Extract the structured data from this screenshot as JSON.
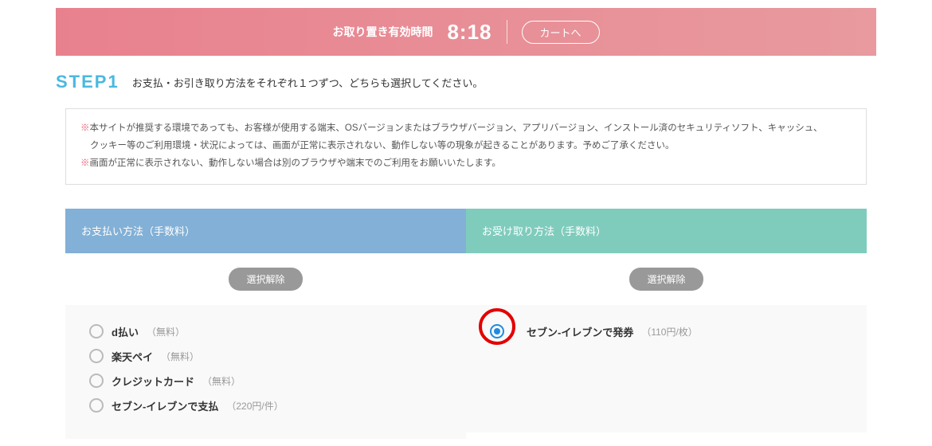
{
  "banner": {
    "label": "お取り置き有効時間",
    "time": "8:18",
    "cart_label": "カートへ"
  },
  "step": {
    "label": "STEP1",
    "desc": "お支払・お引き取り方法をそれぞれ１つずつ、どちらも選択してください。"
  },
  "notice": {
    "mark": "※",
    "line1a": "本サイトが推奨する環境であっても、お客様が使用する端末、OSバージョンまたはブラウザバージョン、アプリバージョン、インストール済のセキュリティソフト、キャッシュ、",
    "line1b": "クッキー等のご利用環境・状況によっては、画面が正常に表示されない、動作しない等の現象が起きることがあります。予めご了承ください。",
    "line2": "画面が正常に表示されない、動作しない場合は別のブラウザや端末でのご利用をお願いいたします。"
  },
  "headers": {
    "payment": "お支払い方法（手数料）",
    "pickup": "お受け取り方法（手数料）"
  },
  "buttons": {
    "clear": "選択解除"
  },
  "payment_options": [
    {
      "label": "d払い",
      "fee": "（無料）"
    },
    {
      "label": "楽天ペイ",
      "fee": "（無料）"
    },
    {
      "label": "クレジットカード",
      "fee": "（無料）"
    },
    {
      "label": "セブン-イレブンで支払",
      "fee": "（220円/件）"
    }
  ],
  "pickup_option": {
    "label": "セブン-イレブンで発券",
    "fee": "（110円/枚）"
  }
}
